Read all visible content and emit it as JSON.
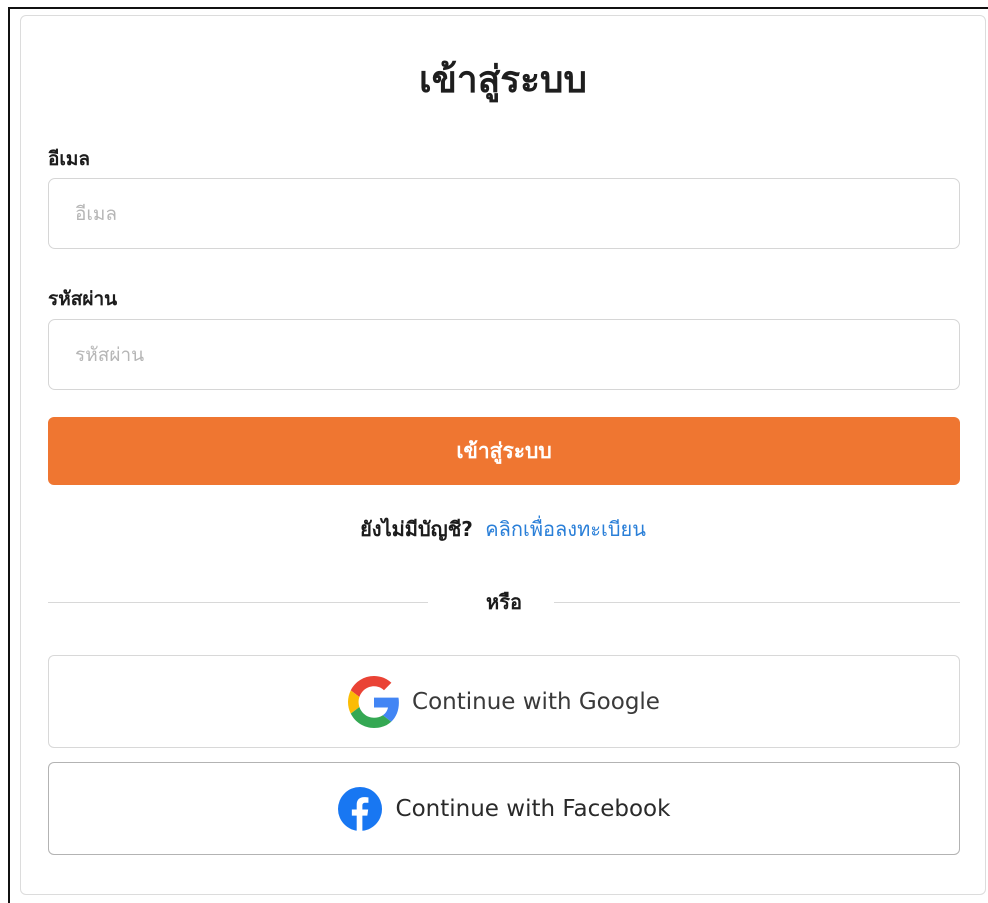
{
  "login": {
    "title": "เข้าสู่ระบบ",
    "email_label": "อีเมล",
    "email_placeholder": "อีเมล",
    "email_value": "",
    "password_label": "รหัสผ่าน",
    "password_placeholder": "รหัสผ่าน",
    "password_value": "",
    "submit_label": "เข้าสู่ระบบ",
    "register_prompt": "ยังไม่มีบัญชี?",
    "register_link": "คลิกเพื่อลงทะเบียน",
    "divider_text": "หรือ",
    "google_label": "Continue with Google",
    "facebook_label": "Continue with Facebook"
  },
  "colors": {
    "primary": "#ef7631",
    "link": "#2a7fd8",
    "facebook": "#1877f2"
  },
  "icons": {
    "google": "google-g-icon",
    "facebook": "facebook-f-icon"
  }
}
